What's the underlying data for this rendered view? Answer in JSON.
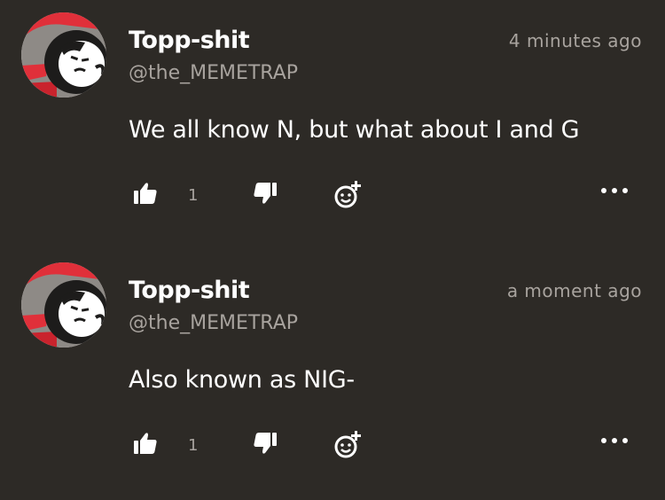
{
  "comments": [
    {
      "username": "Topp-shit",
      "handle": "@the_MEMETRAP",
      "timestamp": "4 minutes ago",
      "text": "We all know N, but what about I and G",
      "like_count": "1"
    },
    {
      "username": "Topp-shit",
      "handle": "@the_MEMETRAP",
      "timestamp": "a moment ago",
      "text": "Also known as NIG-",
      "like_count": "1"
    }
  ],
  "icons": {
    "like": "thumbs-up-icon",
    "dislike": "thumbs-down-icon",
    "react": "add-reaction-icon",
    "more": "more-options-icon"
  },
  "colors": {
    "background": "#2d2a26",
    "text_primary": "#ffffff",
    "text_secondary": "#a8a39e",
    "avatar_accent": "#e0303a"
  }
}
